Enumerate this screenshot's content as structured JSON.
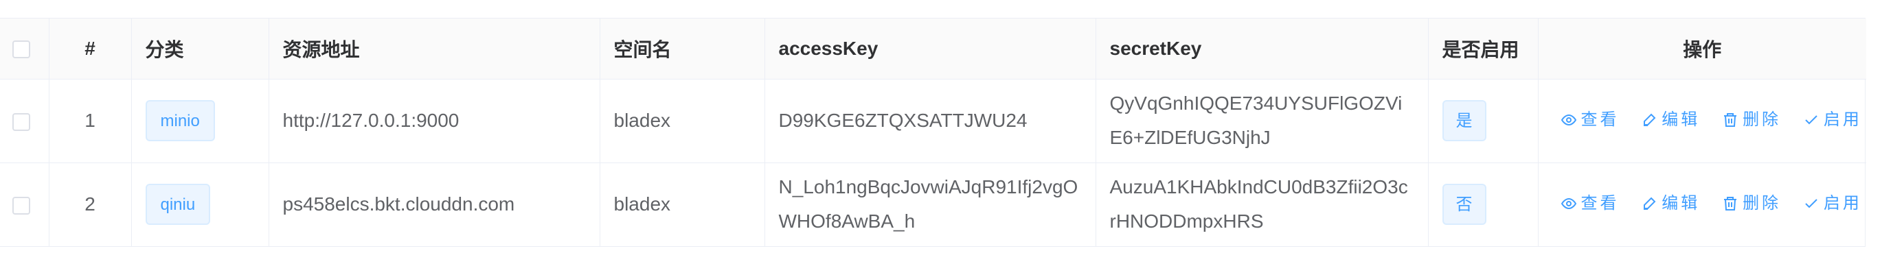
{
  "table": {
    "headers": {
      "index": "#",
      "category": "分类",
      "endpoint": "资源地址",
      "bucket": "空间名",
      "access_key": "accessKey",
      "secret_key": "secretKey",
      "enabled": "是否启用",
      "actions": "操作"
    },
    "rows": [
      {
        "index": "1",
        "category": "minio",
        "endpoint": "http://127.0.0.1:9000",
        "bucket": "bladex",
        "access_key": "D99KGE6ZTQXSATTJWU24",
        "secret_key": "QyVqGnhIQQE734UYSUFlGOZViE6+ZlDEfUG3NjhJ",
        "enabled": "是"
      },
      {
        "index": "2",
        "category": "qiniu",
        "endpoint": "ps458elcs.bkt.clouddn.com",
        "bucket": "bladex",
        "access_key": "N_Loh1ngBqcJovwiAJqR91Ifj2vgOWHOf8AwBA_h",
        "secret_key": "AuzuA1KHAbkIndCU0dB3Zfii2O3crHNODDmpxHRS",
        "enabled": "否"
      }
    ],
    "actions": {
      "view": "查看",
      "edit": "编辑",
      "delete": "删除",
      "enable": "启用"
    }
  },
  "icons": {
    "view": "eye-icon",
    "edit": "edit-icon",
    "delete": "trash-icon",
    "enable": "check-icon"
  },
  "colors": {
    "accent": "#409eff",
    "tag_bg": "#ecf5ff",
    "border": "#ebeef5",
    "header_bg": "#fafafa"
  }
}
